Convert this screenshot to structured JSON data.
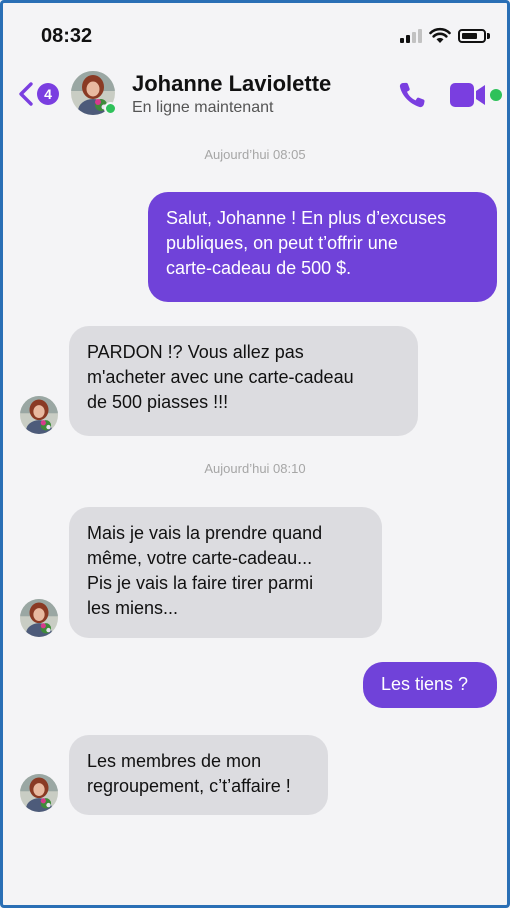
{
  "status_bar": {
    "time": "08:32"
  },
  "header": {
    "back_badge": "4",
    "contact_name": "Johanne Laviolette",
    "contact_status": "En ligne maintenant"
  },
  "colors": {
    "accent": "#7042d9",
    "online": "#2ec15a",
    "incoming_bubble": "#dcdce0"
  },
  "icons": [
    "chevron-left-icon",
    "phone-icon",
    "video-camera-icon",
    "signal-icon",
    "wifi-icon",
    "battery-icon"
  ],
  "messages": [
    {
      "type": "timestamp",
      "text": "Aujourd’hui 08:05"
    },
    {
      "type": "outgoing",
      "lines": [
        "Salut, Johanne ! En plus d’excuses",
        "publiques, on peut t’offrir une",
        "carte-cadeau de 500 $."
      ]
    },
    {
      "type": "incoming",
      "lines": [
        "PARDON !? Vous allez pas",
        "m'acheter avec une carte-cadeau",
        "de 500 piasses !!!"
      ]
    },
    {
      "type": "timestamp",
      "text": "Aujourd’hui 08:10"
    },
    {
      "type": "incoming",
      "lines": [
        "Mais je vais la prendre quand",
        "même, votre carte-cadeau...",
        "Pis je vais la faire tirer parmi",
        "les miens..."
      ]
    },
    {
      "type": "outgoing",
      "lines": [
        "Les tiens ?"
      ]
    },
    {
      "type": "incoming",
      "lines": [
        "Les membres de mon",
        "regroupement, c’t’affaire !"
      ]
    }
  ]
}
